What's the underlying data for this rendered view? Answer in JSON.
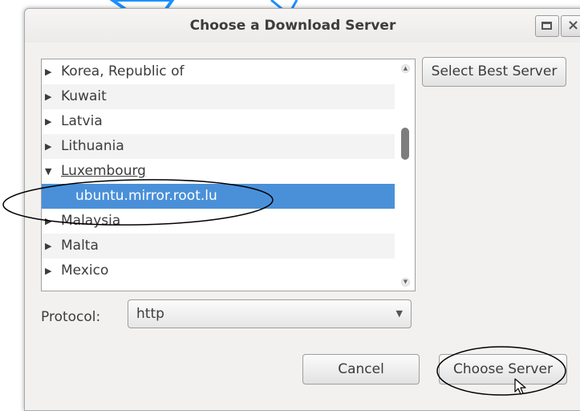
{
  "dialog": {
    "title": "Choose a Download Server",
    "close_glyph": "×"
  },
  "server_list": {
    "rows": [
      {
        "label": "Korea, Republic of",
        "arrow": "▶"
      },
      {
        "label": "Kuwait",
        "arrow": "▶"
      },
      {
        "label": "Latvia",
        "arrow": "▶"
      },
      {
        "label": "Lithuania",
        "arrow": "▶"
      },
      {
        "label": "Luxembourg",
        "arrow": "▼"
      },
      {
        "label": "ubuntu.mirror.root.lu",
        "arrow": ""
      },
      {
        "label": "Malaysia",
        "arrow": "▶"
      },
      {
        "label": "Malta",
        "arrow": "▶"
      },
      {
        "label": "Mexico",
        "arrow": "▶"
      }
    ],
    "selected_index": 5
  },
  "buttons": {
    "select_best": "Select Best Server",
    "cancel": "Cancel",
    "choose": "Choose Server"
  },
  "protocol": {
    "label": "Protocol:",
    "value": "http",
    "arrow": "▼"
  },
  "colors": {
    "selection": "#4a90d9",
    "annotation": "#000000"
  },
  "icons": [
    "maximize-icon",
    "close-icon",
    "expander-icon",
    "dropdown-arrow-icon",
    "mouse-pointer-icon"
  ]
}
